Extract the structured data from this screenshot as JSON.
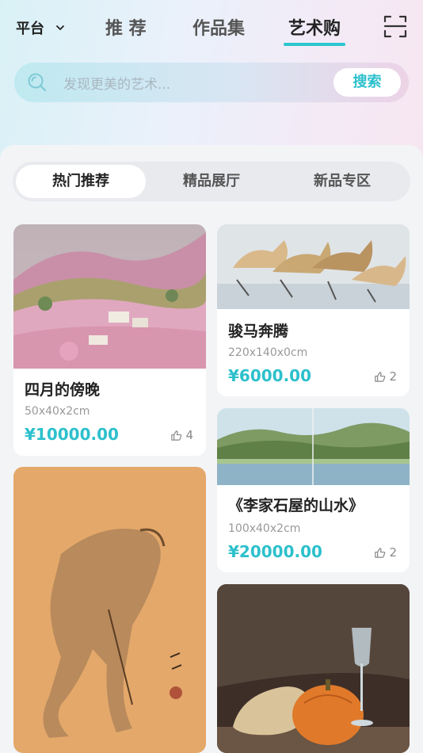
{
  "header": {
    "platform_label": "平台",
    "tabs": [
      {
        "label": "推 荐",
        "active": false
      },
      {
        "label": "作品集",
        "active": false
      },
      {
        "label": "艺术购",
        "active": true
      }
    ],
    "scan_icon": "scan-icon"
  },
  "search": {
    "placeholder": "发现更美的艺术...",
    "button_label": "搜索"
  },
  "segments": [
    {
      "label": "热门推荐",
      "active": true
    },
    {
      "label": "精品展厅",
      "active": false
    },
    {
      "label": "新品专区",
      "active": false
    }
  ],
  "products": [
    {
      "title": "四月的傍晚",
      "size": "50x40x2cm",
      "price": "¥10000.00",
      "likes": "4"
    },
    {
      "title": "骏马奔腾",
      "size": "220x140x0cm",
      "price": "¥6000.00",
      "likes": "2"
    },
    {
      "title": "《李家石屋的山水》",
      "size": "100x40x2cm",
      "price": "¥20000.00",
      "likes": "2"
    },
    {
      "title": "",
      "size": "",
      "price": "",
      "likes": ""
    },
    {
      "title": "",
      "size": "",
      "price": "",
      "likes": ""
    }
  ],
  "colors": {
    "accent": "#2cc0cc",
    "price": "#2cc0cc",
    "underline": "#2cc6cf"
  }
}
